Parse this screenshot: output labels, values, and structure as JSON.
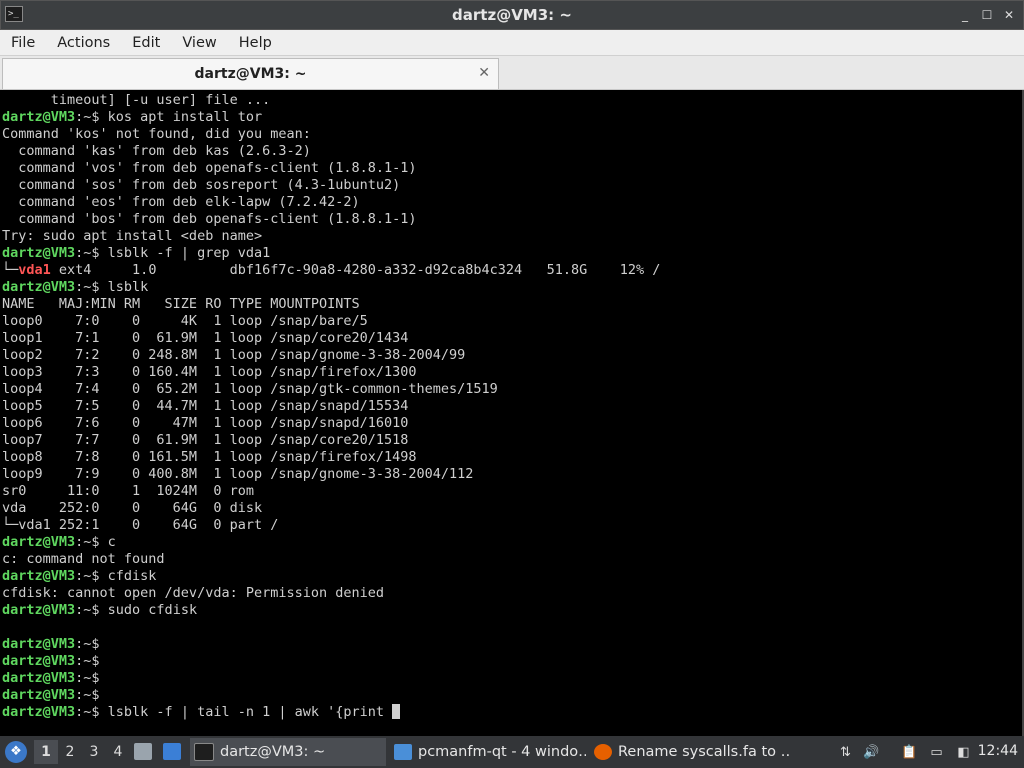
{
  "window": {
    "title": "dartz@VM3: ~",
    "app_icon_glyph": ">_",
    "minimize_glyph": "_",
    "maximize_glyph": "☐",
    "close_glyph": "✕"
  },
  "menu": [
    "File",
    "Actions",
    "Edit",
    "View",
    "Help"
  ],
  "tab": {
    "label": "dartz@VM3: ~",
    "close_glyph": "✕"
  },
  "terminal": {
    "colors": {
      "background": "#000000",
      "text": "#cfcfcf",
      "prompt": "#5fd75f",
      "highlight": "#ff5555"
    },
    "lines": [
      {
        "t": "      timeout] [-u user] file ..."
      },
      {
        "p": "dartz@VM3",
        "c": ":~$ kos apt install tor"
      },
      {
        "t": "Command 'kos' not found, did you mean:"
      },
      {
        "t": "  command 'kas' from deb kas (2.6.3-2)"
      },
      {
        "t": "  command 'vos' from deb openafs-client (1.8.8.1-1)"
      },
      {
        "t": "  command 'sos' from deb sosreport (4.3-1ubuntu2)"
      },
      {
        "t": "  command 'eos' from deb elk-lapw (7.2.42-2)"
      },
      {
        "t": "  command 'bos' from deb openafs-client (1.8.8.1-1)"
      },
      {
        "t": "Try: sudo apt install <deb name>"
      },
      {
        "p": "dartz@VM3",
        "c": ":~$ lsblk -f | grep vda1"
      },
      {
        "pre": "└─",
        "r": "vda1",
        "t": " ext4     1.0         dbf16f7c-90a8-4280-a332-d92ca8b4c324   51.8G    12% /"
      },
      {
        "p": "dartz@VM3",
        "c": ":~$ lsblk"
      },
      {
        "t": "NAME   MAJ:MIN RM   SIZE RO TYPE MOUNTPOINTS"
      },
      {
        "t": "loop0    7:0    0     4K  1 loop /snap/bare/5"
      },
      {
        "t": "loop1    7:1    0  61.9M  1 loop /snap/core20/1434"
      },
      {
        "t": "loop2    7:2    0 248.8M  1 loop /snap/gnome-3-38-2004/99"
      },
      {
        "t": "loop3    7:3    0 160.4M  1 loop /snap/firefox/1300"
      },
      {
        "t": "loop4    7:4    0  65.2M  1 loop /snap/gtk-common-themes/1519"
      },
      {
        "t": "loop5    7:5    0  44.7M  1 loop /snap/snapd/15534"
      },
      {
        "t": "loop6    7:6    0    47M  1 loop /snap/snapd/16010"
      },
      {
        "t": "loop7    7:7    0  61.9M  1 loop /snap/core20/1518"
      },
      {
        "t": "loop8    7:8    0 161.5M  1 loop /snap/firefox/1498"
      },
      {
        "t": "loop9    7:9    0 400.8M  1 loop /snap/gnome-3-38-2004/112"
      },
      {
        "t": "sr0     11:0    1  1024M  0 rom"
      },
      {
        "t": "vda    252:0    0    64G  0 disk"
      },
      {
        "t": "└─vda1 252:1    0    64G  0 part /"
      },
      {
        "p": "dartz@VM3",
        "c": ":~$ c"
      },
      {
        "t": "c: command not found"
      },
      {
        "p": "dartz@VM3",
        "c": ":~$ cfdisk"
      },
      {
        "t": "cfdisk: cannot open /dev/vda: Permission denied"
      },
      {
        "p": "dartz@VM3",
        "c": ":~$ sudo cfdisk"
      },
      {
        "t": ""
      },
      {
        "p": "dartz@VM3",
        "c": ":~$"
      },
      {
        "p": "dartz@VM3",
        "c": ":~$"
      },
      {
        "p": "dartz@VM3",
        "c": ":~$"
      },
      {
        "p": "dartz@VM3",
        "c": ":~$"
      },
      {
        "p": "dartz@VM3",
        "c": ":~$ lsblk -f | tail -n 1 | awk '{print ",
        "cursor": true
      }
    ]
  },
  "taskbar": {
    "start_glyph": "❖",
    "desktops": [
      "1",
      "2",
      "3",
      "4"
    ],
    "active_desktop": "1",
    "tasks": [
      {
        "label": "dartz@VM3: ~",
        "icon": "terminal-icon",
        "color": "#1e1e1e"
      },
      {
        "label": "pcmanfm-qt - 4 windo…",
        "icon": "folder-icon",
        "color": "#4a8fd8"
      },
      {
        "label": "Rename syscalls.fa to …",
        "icon": "firefox-icon",
        "color": "#e66000"
      }
    ],
    "tray": {
      "network_glyph": "⇅",
      "volume_glyph": "🔊",
      "clipboard_glyph": "📋",
      "display_glyph": "▭",
      "monitor_glyph": "◧"
    },
    "clock": "12:44"
  }
}
